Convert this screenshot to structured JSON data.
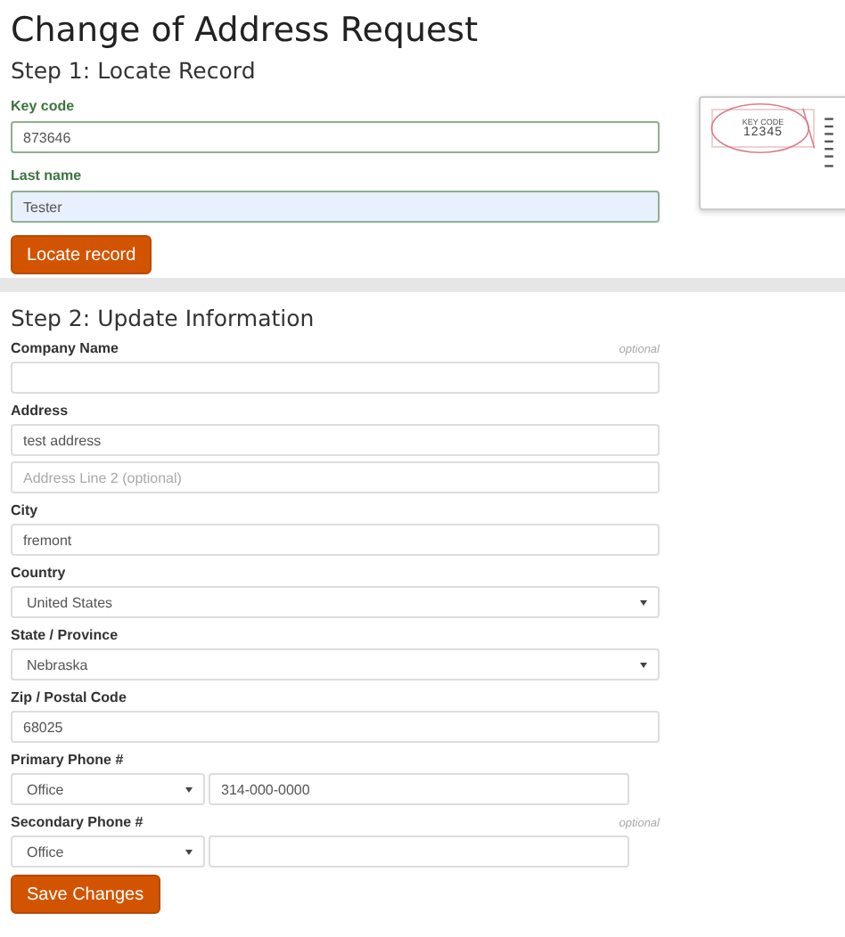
{
  "title": "Change of Address Request",
  "step1": {
    "heading": "Step 1: Locate Record",
    "fields": [
      {
        "label": "Key code",
        "value": "873646",
        "autofilled": false
      },
      {
        "label": "Last name",
        "value": "Tester",
        "autofilled": true
      }
    ],
    "button": "Locate record",
    "sample_label": {
      "caption": "KEY CODE",
      "code": "12345"
    }
  },
  "step2": {
    "heading": "Step 2: Update Information",
    "fields": [
      {
        "kind": "blank",
        "label": "Company Name",
        "optional": "optional"
      },
      {
        "kind": "text",
        "label": "Address",
        "inputs": [
          {
            "value": "test address"
          },
          {
            "placeholder": "Address Line 2 (optional)"
          }
        ]
      },
      {
        "kind": "text",
        "label": "City",
        "inputs": [
          {
            "value": "fremont"
          }
        ]
      },
      {
        "kind": "select",
        "label": "Country",
        "value": "United States"
      },
      {
        "kind": "select",
        "label": "State / Province",
        "value": "Nebraska"
      },
      {
        "kind": "text",
        "label": "Zip / Postal Code",
        "inputs": [
          {
            "value": "68025"
          }
        ]
      },
      {
        "kind": "phone",
        "label": "Primary Phone #",
        "type": "Office",
        "number": "314-000-0000"
      },
      {
        "kind": "phone",
        "label": "Secondary Phone #",
        "optional": "optional",
        "type": "Office"
      }
    ],
    "button": "Save Changes"
  }
}
